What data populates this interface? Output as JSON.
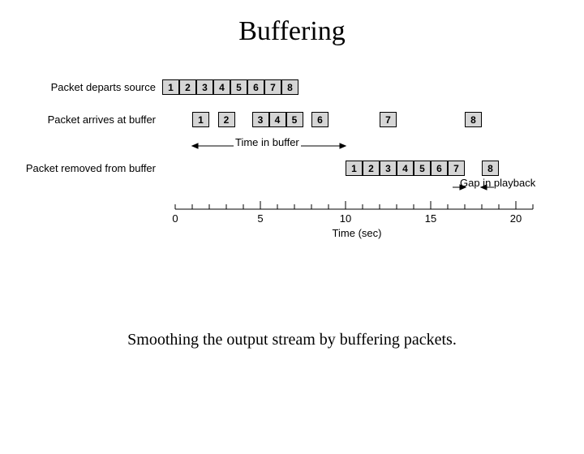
{
  "title": "Buffering",
  "caption": "Smoothing the output stream by buffering packets.",
  "rows": {
    "depart": "Packet departs source",
    "arrive": "Packet arrives at buffer",
    "remove": "Packet removed from buffer"
  },
  "annotations": {
    "time_in_buffer": "Time in buffer",
    "gap_in_playback": "Gap in playback"
  },
  "axis": {
    "label": "Time (sec)",
    "ticks": [
      "0",
      "5",
      "10",
      "15",
      "20"
    ]
  },
  "chart_data": {
    "type": "timeline",
    "xlabel": "Time (sec)",
    "xlim": [
      0,
      21
    ],
    "series": [
      {
        "name": "Packet departs source",
        "packets": [
          [
            1,
            0
          ],
          [
            2,
            1
          ],
          [
            3,
            2
          ],
          [
            4,
            3
          ],
          [
            5,
            4
          ],
          [
            6,
            5
          ],
          [
            7,
            6
          ],
          [
            8,
            7
          ]
        ]
      },
      {
        "name": "Packet arrives at buffer",
        "packets": [
          [
            1,
            1
          ],
          [
            2,
            2.5
          ],
          [
            3,
            4.5
          ],
          [
            4,
            5.5
          ],
          [
            5,
            6.5
          ],
          [
            6,
            8
          ],
          [
            7,
            12
          ],
          [
            8,
            17
          ]
        ]
      },
      {
        "name": "Packet removed from buffer",
        "packets": [
          [
            1,
            10
          ],
          [
            2,
            11
          ],
          [
            3,
            12
          ],
          [
            4,
            13
          ],
          [
            5,
            14
          ],
          [
            6,
            15
          ],
          [
            7,
            16
          ],
          [
            8,
            18
          ]
        ]
      }
    ],
    "annotations": [
      {
        "text": "Time in buffer",
        "x_range": [
          1,
          10
        ],
        "row": 2
      },
      {
        "text": "Gap in playback",
        "x_range": [
          17,
          18
        ],
        "row": 3
      }
    ]
  }
}
